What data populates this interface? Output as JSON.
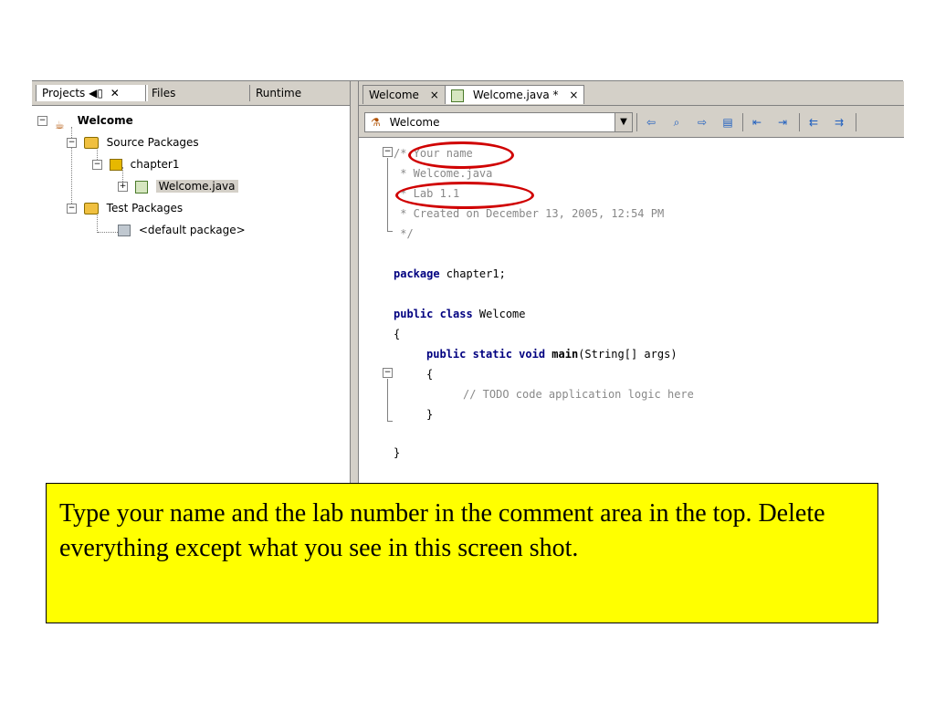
{
  "left_panel": {
    "tabs": [
      {
        "label": "Projects ◀▯",
        "close": "✕",
        "active": true
      },
      {
        "label": "Files"
      },
      {
        "label": "Runtime"
      }
    ],
    "tree": {
      "project": "Welcome",
      "source_packages": "Source Packages",
      "package": "chapter1",
      "file": "Welcome.java",
      "test_packages": "Test Packages",
      "default_package": "<default package>"
    }
  },
  "editor": {
    "tabs": [
      {
        "label": "Welcome",
        "close": "×"
      },
      {
        "label": "Welcome.java *",
        "close": "×",
        "active": true
      }
    ],
    "combo_value": "Welcome",
    "code": {
      "l1": "/* Your name",
      "l2": " * Welcome.java",
      "l3": " * Lab 1.1",
      "l4": " * Created on December 13, 2005, 12:54 PM",
      "l5": " */",
      "pkg_kw": "package",
      "pkg_rest": " chapter1;",
      "cls_kw": "public class",
      "cls_rest": " Welcome",
      "brace_open": "{",
      "main_kw": "public static void",
      "main_name": "main",
      "main_rest": "(String[] args)",
      "inner_open": "{",
      "todo": "// TODO code application logic here",
      "inner_close": "}",
      "brace_close": "}"
    }
  },
  "note": {
    "text": "Type your name and the lab number in the comment area in the top. Delete everything except what you see in this screen shot."
  },
  "colors": {
    "highlight_ring": "#d00000",
    "note_background": "#ffff00",
    "keyword": "#000080",
    "comment": "#888888"
  }
}
